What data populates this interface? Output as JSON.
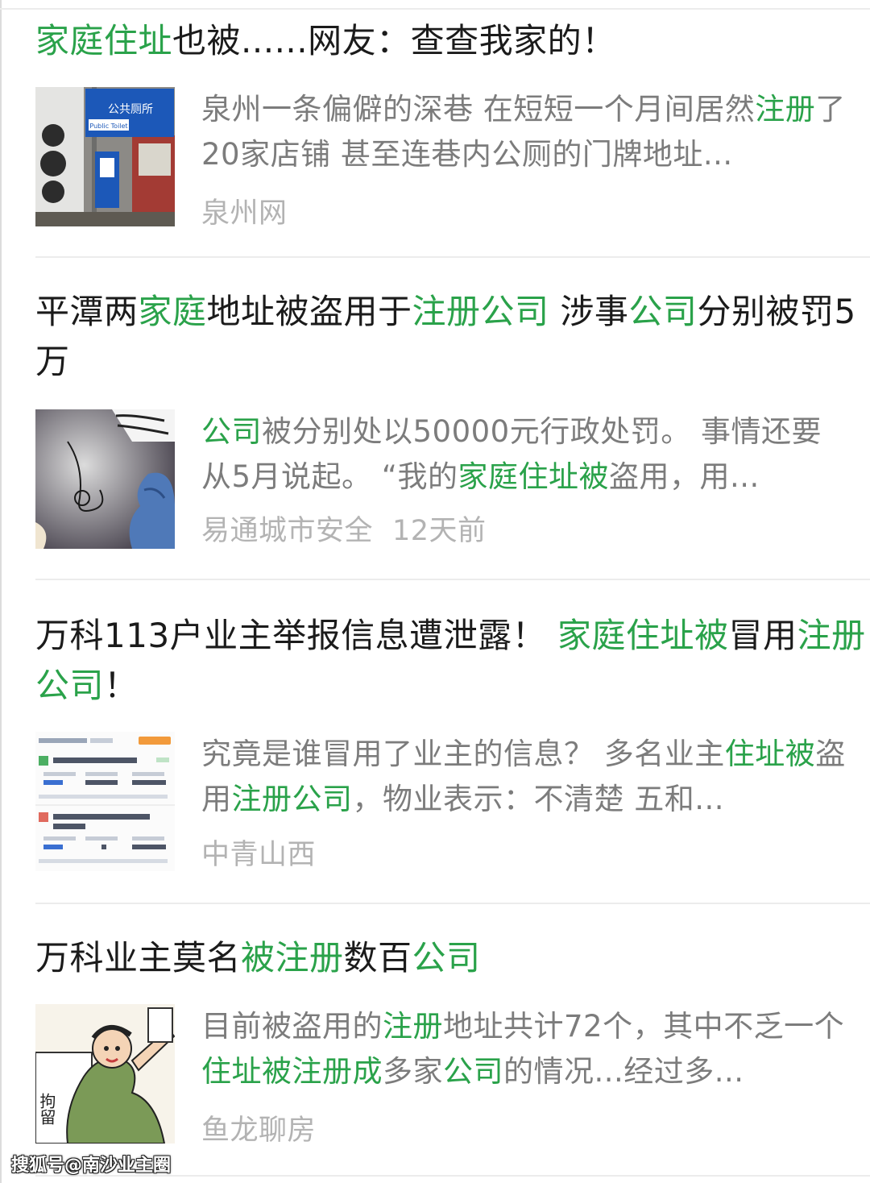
{
  "articles": [
    {
      "title_parts": [
        {
          "text": "家庭住址",
          "hl": true
        },
        {
          "text": "也被......网友：查查我家的！",
          "hl": false
        }
      ],
      "snippet_parts": [
        {
          "text": "泉州一条偏僻的深巷 在短短一个月间居然",
          "hl": false
        },
        {
          "text": "注册",
          "hl": true
        },
        {
          "text": "了20家店铺 甚至连巷内公厕的门牌地址...",
          "hl": false
        }
      ],
      "source": "泉州网",
      "time": "",
      "thumb_icon": "street-sign-photo",
      "thumb_sign_cn": "公共厕所",
      "thumb_sign_en": "Public Toilet"
    },
    {
      "title_parts": [
        {
          "text": "平潭两",
          "hl": false
        },
        {
          "text": "家庭",
          "hl": true
        },
        {
          "text": "地址被盗用于",
          "hl": false
        },
        {
          "text": "注册公司",
          "hl": true
        },
        {
          "text": " 涉事",
          "hl": false
        },
        {
          "text": "公司",
          "hl": true
        },
        {
          "text": "分别被罚5万",
          "hl": false
        }
      ],
      "snippet_parts": [
        {
          "text": "公司",
          "hl": true
        },
        {
          "text": "被分别处以50000元行政处罚。 事情还要从5月说起。 “我的",
          "hl": false
        },
        {
          "text": "家庭住址被",
          "hl": true
        },
        {
          "text": "盗用，用...",
          "hl": false
        }
      ],
      "source": "易通城市安全",
      "time": "12天前",
      "thumb_icon": "cartoon-hand-illustration"
    },
    {
      "title_parts": [
        {
          "text": "万科113户业主举报信息遭泄露！ ",
          "hl": false
        },
        {
          "text": "家庭住址被",
          "hl": true
        },
        {
          "text": "冒用",
          "hl": false
        },
        {
          "text": "注册公司",
          "hl": true
        },
        {
          "text": "！",
          "hl": false
        }
      ],
      "snippet_parts": [
        {
          "text": "究竟是谁冒用了业主的信息？ 多名业主",
          "hl": false
        },
        {
          "text": "住址被",
          "hl": true
        },
        {
          "text": "盗用",
          "hl": false
        },
        {
          "text": "注册公司",
          "hl": true
        },
        {
          "text": "，物业表示：不清楚 五和...",
          "hl": false
        }
      ],
      "source": "中青山西",
      "time": "",
      "thumb_icon": "company-list-screenshot"
    },
    {
      "title_parts": [
        {
          "text": "万科业主莫名",
          "hl": false
        },
        {
          "text": "被注册",
          "hl": true
        },
        {
          "text": "数百",
          "hl": false
        },
        {
          "text": "公司",
          "hl": true
        }
      ],
      "snippet_parts": [
        {
          "text": "目前被盗用的",
          "hl": false
        },
        {
          "text": "注册",
          "hl": true
        },
        {
          "text": "地址共计72个，其中不乏一个",
          "hl": false
        },
        {
          "text": "住址被注册成",
          "hl": true
        },
        {
          "text": "多家",
          "hl": false
        },
        {
          "text": "公司",
          "hl": true
        },
        {
          "text": "的情况...经过多...",
          "hl": false
        }
      ],
      "source": "鱼龙聊房",
      "time": "",
      "thumb_icon": "detention-cartoon",
      "thumb_caption": "拘留"
    }
  ],
  "watermark": "搜狐号@南沙业主圈",
  "colors": {
    "highlight": "#2aa24a",
    "title": "#1b1b1b",
    "snippet": "#7c7c7c",
    "source": "#b3b3b3"
  }
}
